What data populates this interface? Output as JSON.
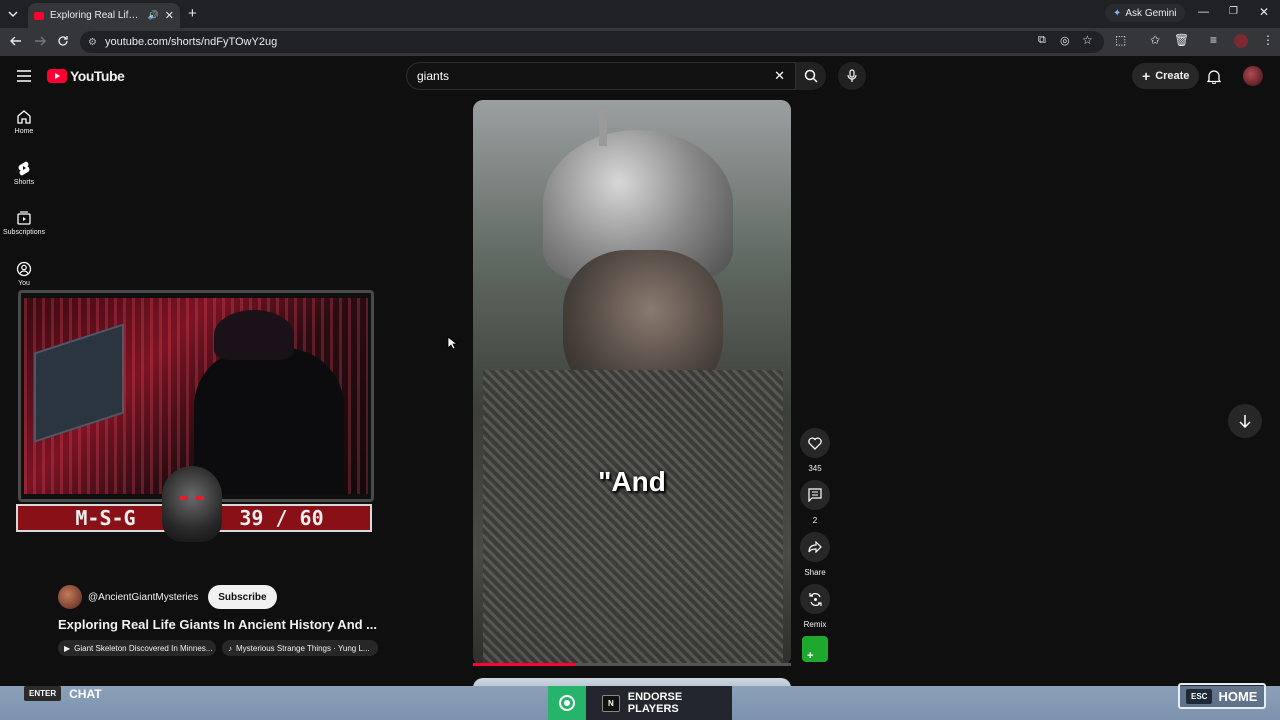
{
  "browser": {
    "tab_title": "Exploring Real Life Giants In",
    "url": "youtube.com/shorts/ndFyTOwY2ug",
    "ask_gemini": "Ask Gemini"
  },
  "header": {
    "logo_text": "YouTube",
    "search_value": "giants",
    "create_label": "Create"
  },
  "nav": {
    "home": "Home",
    "shorts": "Shorts",
    "subscriptions": "Subscriptions",
    "you": "You"
  },
  "stream_overlay": {
    "name": "M-S-G",
    "count": "39 / 60"
  },
  "video": {
    "caption": "\"And",
    "progress": 0.32,
    "likes": "345",
    "comments": "2",
    "share_label": "Share",
    "remix_label": "Remix"
  },
  "channel": {
    "handle": "@AncientGiantMysteries",
    "subscribe_label": "Subscribe",
    "title": "Exploring Real Life Giants In Ancient History And ...",
    "chip_related": "Giant Skeleton Discovered In Minnes...",
    "chip_music": "Mysterious Strange Things · Yung L..."
  },
  "bottom": {
    "enter_key": "ENTER",
    "chat_label": "CHAT",
    "endorse_key": "N",
    "endorse_label": "ENDORSE PLAYERS",
    "esc_key": "ESC",
    "home_label": "HOME"
  },
  "colors": {
    "yt_red": "#ff0033",
    "background": "#0f0f0f",
    "endorse_green": "#25b46a"
  }
}
